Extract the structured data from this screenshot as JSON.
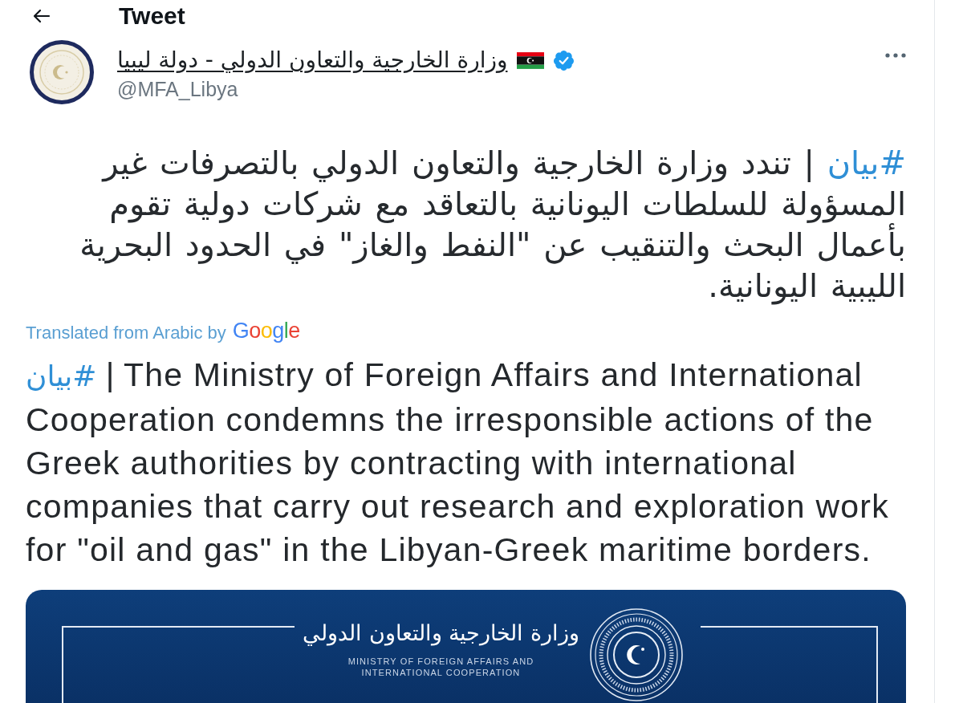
{
  "header": {
    "title": "Tweet"
  },
  "author": {
    "name": "وزارة الخارجية والتعاون الدولي - دولة ليبيا",
    "handle": "@MFA_Libya",
    "verified": true
  },
  "tweet": {
    "original": {
      "hashtag": "#بيان",
      "text": "| تندد وزارة الخارجية والتعاون الدولي بالتصرفات غير المسؤولة للسلطات اليونانية بالتعاقد مع شركات دولية تقوم بأعمال البحث والتنقيب عن \"النفط والغاز\" في الحدود البحرية الليبية اليونانية."
    },
    "translation_note": "Translated from Arabic by",
    "translator": "Google",
    "translated": {
      "hashtag": "#بيان",
      "text": "| The Ministry of Foreign Affairs and International Cooperation condemns the irresponsible actions of the Greek authorities by contracting with international companies that carry out research and exploration work for \"oil and gas\" in the Libyan-Greek maritime borders."
    }
  },
  "attachment": {
    "title": "وزارة الخارجية والتعاون الدولي",
    "caption": "MINISTRY OF FOREIGN AFFAIRS AND INTERNATIONAL COOPERATION"
  }
}
